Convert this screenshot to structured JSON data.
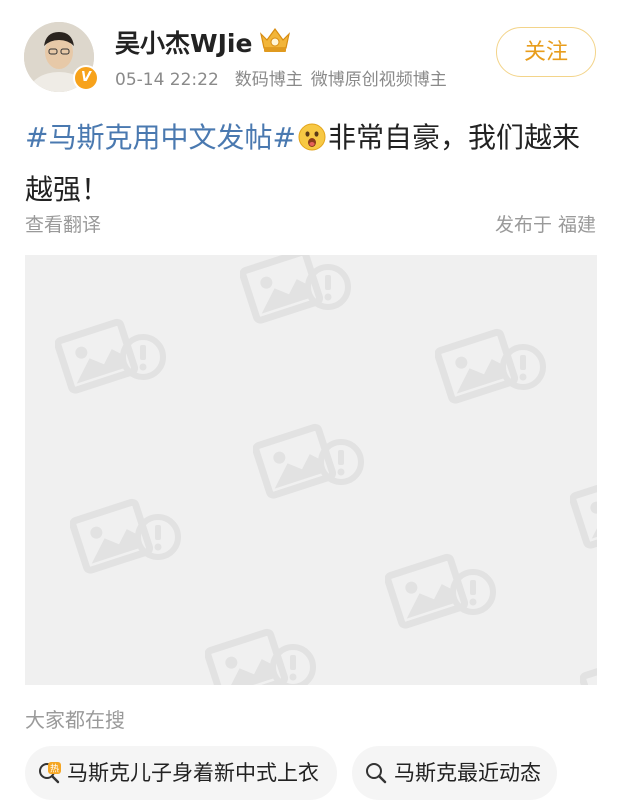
{
  "post": {
    "author": {
      "name": "吴小杰WJie",
      "verified_badge": "V",
      "time": "05-14 22:22",
      "tags": [
        "数码博主",
        "微博原创视频博主"
      ],
      "follow_label": "关注"
    },
    "content": {
      "hashtag": "#马斯克用中文发帖#",
      "emoji_icon": "surprised-face-emoji",
      "text": "非常自豪，我们越来越强！"
    },
    "translate_label": "查看翻译",
    "location": "发布于 福建",
    "image_status": "image-failed-placeholder"
  },
  "search": {
    "title": "大家都在搜",
    "chips": [
      {
        "label": "马斯克儿子身着新中式上衣",
        "icon": "hot-search-icon",
        "badge": "热"
      },
      {
        "label": "马斯克最近动态",
        "icon": "search-icon"
      }
    ]
  },
  "colors": {
    "hashtag": "#4a79b0",
    "follow": "#e89d1c",
    "follow_border": "#f3d48a",
    "verified": "#f7a21b",
    "hot_badge": "#f5a623",
    "muted_text": "#9a9a9a"
  }
}
